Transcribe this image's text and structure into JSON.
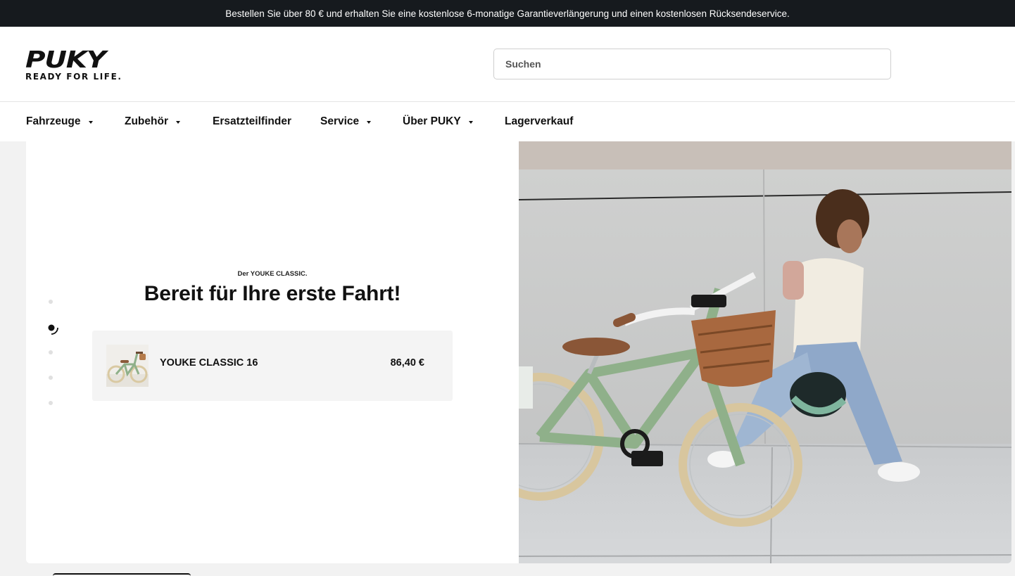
{
  "announcement": "Bestellen Sie über 80 € und erhalten Sie eine kostenlose 6-monatige Garantieverlängerung und einen kostenlosen Rücksendeservice.",
  "logo": {
    "word": "PUKY",
    "tagline": "READY FOR LIFE."
  },
  "search": {
    "placeholder": "Suchen"
  },
  "nav": {
    "items": [
      {
        "label": "Fahrzeuge",
        "dropdown": true
      },
      {
        "label": "Zubehör",
        "dropdown": true
      },
      {
        "label": "Ersatzteilfinder",
        "dropdown": false
      },
      {
        "label": "Service",
        "dropdown": true
      },
      {
        "label": "Über PUKY",
        "dropdown": true
      },
      {
        "label": "Lagerverkauf",
        "dropdown": false
      }
    ]
  },
  "hero": {
    "eyebrow": "Der YOUKE CLASSIC.",
    "title": "Bereit für Ihre erste Fahrt!",
    "product": {
      "name": "YOUKE CLASSIC 16",
      "price": "86,40 €"
    },
    "slides": {
      "count": 5,
      "active": 2
    }
  },
  "colors": {
    "announcement_bg": "#161a1e",
    "bike_green": "#8fb08a",
    "card_bg": "#f4f4f4"
  }
}
